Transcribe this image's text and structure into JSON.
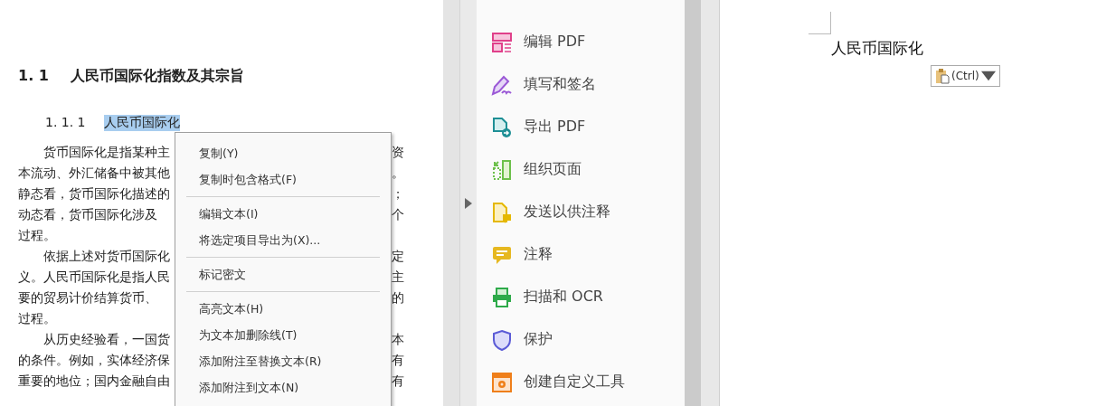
{
  "document": {
    "heading_number": "1. 1",
    "heading": "人民币国际化指数及其宗旨",
    "subheading_number": "1. 1. 1",
    "subheading": "人民币国际化",
    "subheading_selected": true,
    "lines": [
      {
        "left": "货币国际化是指某种主",
        "right": "资",
        "indent": true
      },
      {
        "left": "本流动、外汇储备中被其他",
        "right": "。",
        "indent": false
      },
      {
        "left": "静态看，货币国际化描述的",
        "right": "；",
        "indent": false
      },
      {
        "left": "动态看，货币国际化涉及",
        "right": "个",
        "indent": false
      },
      {
        "left": "过程。",
        "indent": false
      },
      {
        "left": "依据上述对货币国际化",
        "right": "定",
        "indent": true
      },
      {
        "left": "义。人民币国际化是指人民",
        "right": "主",
        "indent": false
      },
      {
        "left": "要的贸易计价结算货币、",
        "right": "的",
        "indent": false
      },
      {
        "left": "过程。",
        "indent": false
      },
      {
        "left": "从历史经验看，一国货",
        "right": "本",
        "indent": true
      },
      {
        "left": "的条件。例如，实体经济保",
        "right": "有",
        "indent": false
      },
      {
        "left": "重要的地位；国内金融自由",
        "right": "有",
        "indent": false
      }
    ]
  },
  "context_menu": {
    "groups": [
      [
        "复制(Y)",
        "复制时包含格式(F)"
      ],
      [
        "编辑文本(I)",
        "将选定项目导出为(X)..."
      ],
      [
        "标记密文"
      ],
      [
        "高亮文本(H)",
        "为文本加删除线(T)",
        "添加附注至替换文本(R)",
        "添加附注到文本(N)"
      ]
    ]
  },
  "tools_panel": {
    "items": [
      {
        "kind": "edit",
        "label": "编辑 PDF"
      },
      {
        "kind": "sign",
        "label": "填写和签名"
      },
      {
        "kind": "export",
        "label": "导出 PDF"
      },
      {
        "kind": "organize",
        "label": "组织页面"
      },
      {
        "kind": "send",
        "label": "发送以供注释"
      },
      {
        "kind": "comment",
        "label": "注释"
      },
      {
        "kind": "scan",
        "label": "扫描和 OCR"
      },
      {
        "kind": "protect",
        "label": "保护"
      },
      {
        "kind": "custom",
        "label": "创建自定义工具"
      }
    ]
  },
  "word_document": {
    "text": "人民币国际化",
    "paste_options": {
      "label": "(Ctrl)"
    }
  }
}
